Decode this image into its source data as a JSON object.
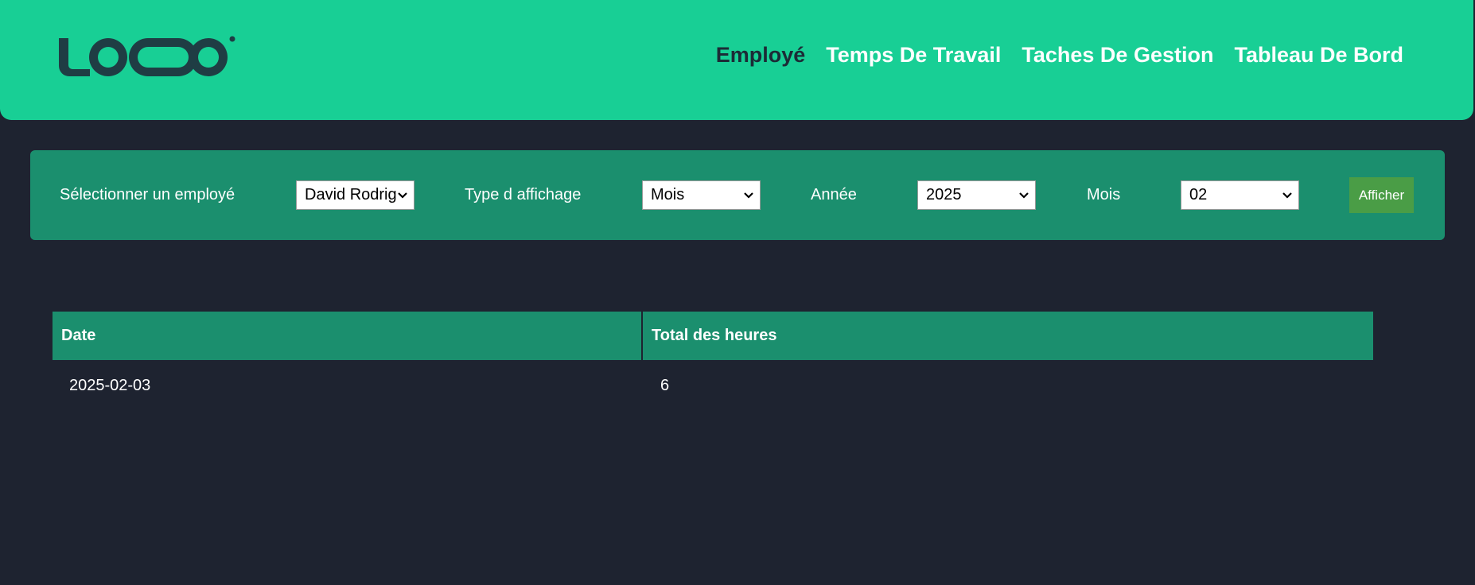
{
  "header": {
    "logo_text": "LOQO",
    "nav": [
      {
        "label": "Employé",
        "active": true
      },
      {
        "label": "Temps De Travail",
        "active": false
      },
      {
        "label": "Taches De Gestion",
        "active": false
      },
      {
        "label": "Tableau De Bord",
        "active": false
      }
    ]
  },
  "filters": {
    "employee_label": "Sélectionner un employé",
    "employee_value": "David Rodriguez",
    "display_type_label": "Type d affichage",
    "display_type_value": "Mois",
    "year_label": "Année",
    "year_value": "2025",
    "month_label": "Mois",
    "month_value": "02",
    "submit_label": "Afficher"
  },
  "table": {
    "headers": [
      "Date",
      "Total des heures"
    ],
    "rows": [
      [
        "2025-02-03",
        "6"
      ]
    ]
  },
  "colors": {
    "header_bg": "#18cf95",
    "panel_bg": "#1b8f6e",
    "page_bg": "#1e2330",
    "button_bg": "#4a9d46",
    "nav_active": "#1c2b36"
  }
}
